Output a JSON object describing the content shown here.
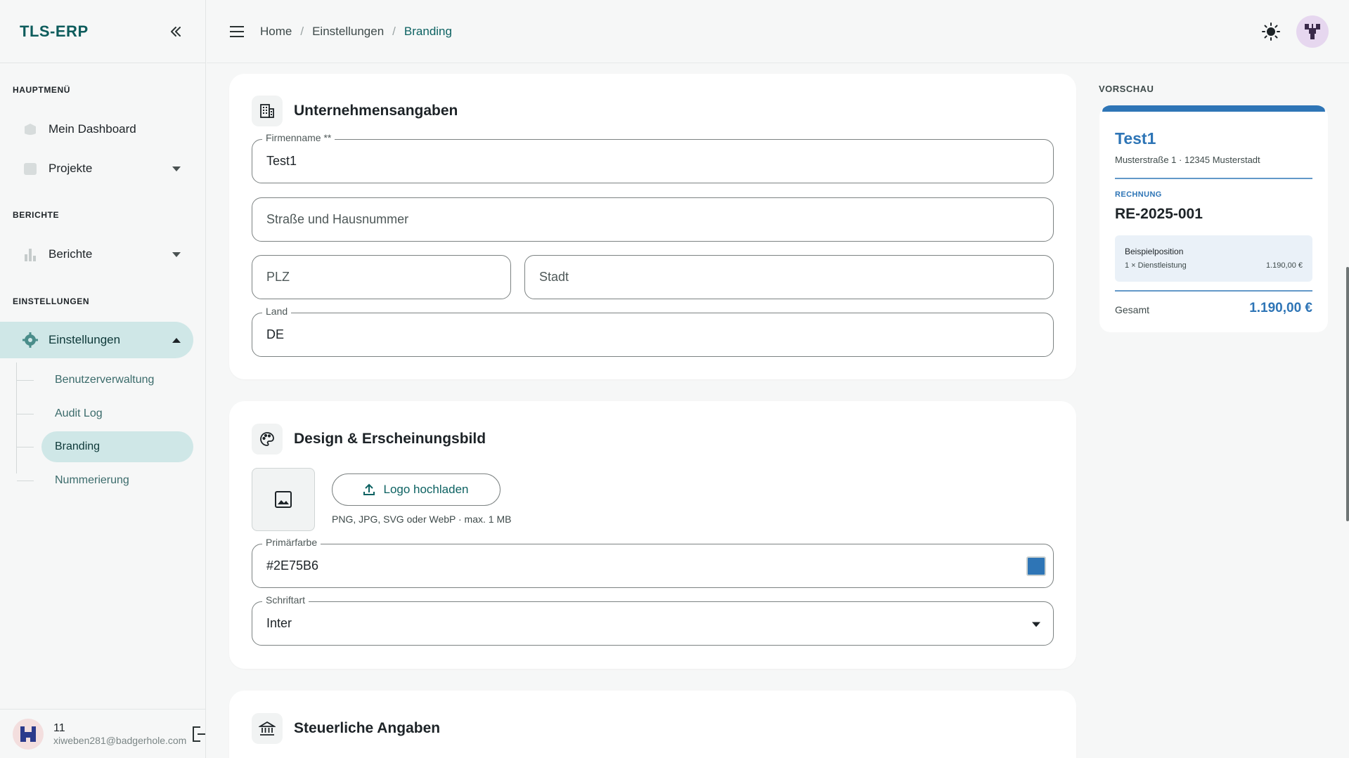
{
  "app": {
    "brand": "TLS-ERP"
  },
  "sidebar": {
    "sections": {
      "main": "HAUPTMENÜ",
      "reports": "BERICHTE",
      "settings": "EINSTELLUNGEN"
    },
    "items": {
      "dashboard": "Mein Dashboard",
      "projects": "Projekte",
      "reports": "Berichte",
      "settings": "Einstellungen"
    },
    "subitems": {
      "users": "Benutzerverwaltung",
      "audit": "Audit Log",
      "branding": "Branding",
      "numbering": "Nummerierung"
    },
    "user": {
      "name": "11",
      "email": "xiweben281@badgerhole.com"
    }
  },
  "breadcrumb": {
    "home": "Home",
    "settings": "Einstellungen",
    "current": "Branding",
    "sep": "/"
  },
  "company": {
    "title": "Unternehmensangaben",
    "name_label": "Firmenname **",
    "name_value": "Test1",
    "street_placeholder": "Straße und Hausnummer",
    "zip_placeholder": "PLZ",
    "city_placeholder": "Stadt",
    "country_label": "Land",
    "country_value": "DE"
  },
  "design": {
    "title": "Design & Erscheinungsbild",
    "upload_label": "Logo hochladen",
    "upload_hint": "PNG, JPG, SVG oder WebP · max. 1 MB",
    "primary_label": "Primärfarbe",
    "primary_value": "#2E75B6",
    "font_label": "Schriftart",
    "font_value": "Inter"
  },
  "tax": {
    "title": "Steuerliche Angaben"
  },
  "preview": {
    "label": "VORSCHAU",
    "company": "Test1",
    "address": "Musterstraße 1 · 12345 Musterstadt",
    "doc_type": "RECHNUNG",
    "doc_number": "RE-2025-001",
    "item_title": "Beispielposition",
    "item_desc": "1 × Dienstleistung",
    "item_amount": "1.190,00 €",
    "total_label": "Gesamt",
    "total_value": "1.190,00 €"
  },
  "colors": {
    "primary": "#2E75B6",
    "accent": "#0d6262",
    "active_bg": "#cfe7e7"
  }
}
